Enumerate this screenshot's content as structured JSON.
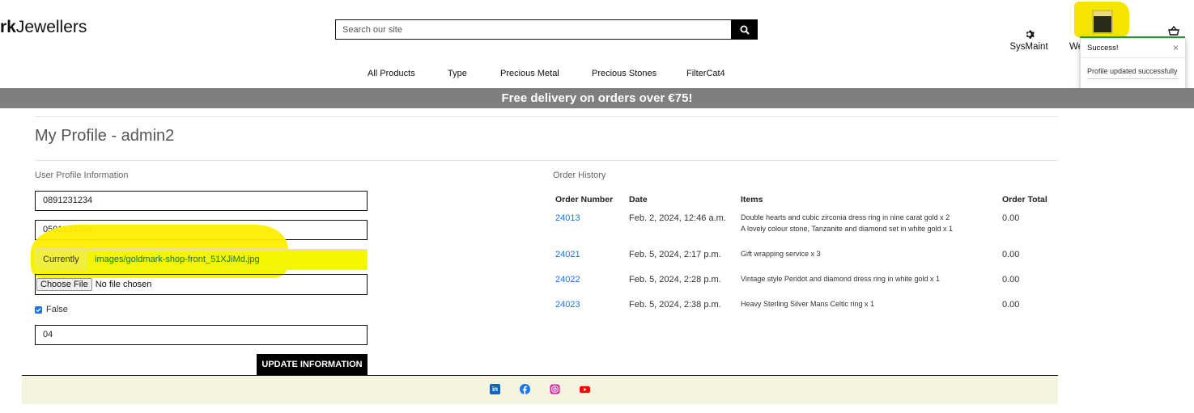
{
  "header": {
    "logo_bold": "rk",
    "logo_rest": "Jewellers",
    "search_placeholder": "Search our site",
    "sysmaint_label": "SysMaint",
    "welcome_label": "We"
  },
  "toast": {
    "title": "Success!",
    "close": "×",
    "message": "Profile updated successfully",
    "accent_color": "#2e9a3a"
  },
  "nav": {
    "items": [
      "All Products",
      "Type",
      "Precious Metal",
      "Precious Stones",
      "FilterCat4"
    ]
  },
  "banner": {
    "text": "Free delivery on orders over €75!",
    "background": "#7f7f7f"
  },
  "profile": {
    "title": "My Profile - admin2",
    "section_label": "User Profile Information",
    "phone1": "0891231234",
    "phone2": "0591231234",
    "currently_label": "Currently",
    "image_path": "images/goldmark-shop-front_51XJiMd.jpg",
    "choose_file_label": "Choose File",
    "no_file_text": "No file chosen",
    "checkbox_label": "False",
    "checkbox_checked": true,
    "field4": "04",
    "update_button": "UPDATE INFORMATION"
  },
  "order_history": {
    "section_label": "Order History",
    "headers": [
      "Order Number",
      "Date",
      "Items",
      "Order Total"
    ],
    "rows": [
      {
        "number": "24013",
        "date": "Feb. 2, 2024, 12:46 a.m.",
        "items": [
          "Double hearts and cubic zirconia dress ring in nine carat gold x 2",
          "A lovely colour stone, Tanzanite and diamond set in white gold x 1"
        ],
        "total": "0.00"
      },
      {
        "number": "24021",
        "date": "Feb. 5, 2024, 2:17 p.m.",
        "items": [
          "Gift wrapping service x 3"
        ],
        "total": "0.00"
      },
      {
        "number": "24022",
        "date": "Feb. 5, 2024, 2:28 p.m.",
        "items": [
          "Vintage style Peridot and diamond dress ring in white gold x 1"
        ],
        "total": "0.00"
      },
      {
        "number": "24023",
        "date": "Feb. 5, 2024, 2:38 p.m.",
        "items": [
          "Heavy Sterling Silver Mans Celtic ring x 1"
        ],
        "total": "0.00"
      }
    ]
  },
  "footer": {
    "social_icons": [
      "linkedin-icon",
      "facebook-icon",
      "instagram-icon",
      "youtube-icon"
    ],
    "background": "#f5f4e1"
  },
  "colors": {
    "highlight": "#fcee00",
    "link": "#1a73e8"
  }
}
